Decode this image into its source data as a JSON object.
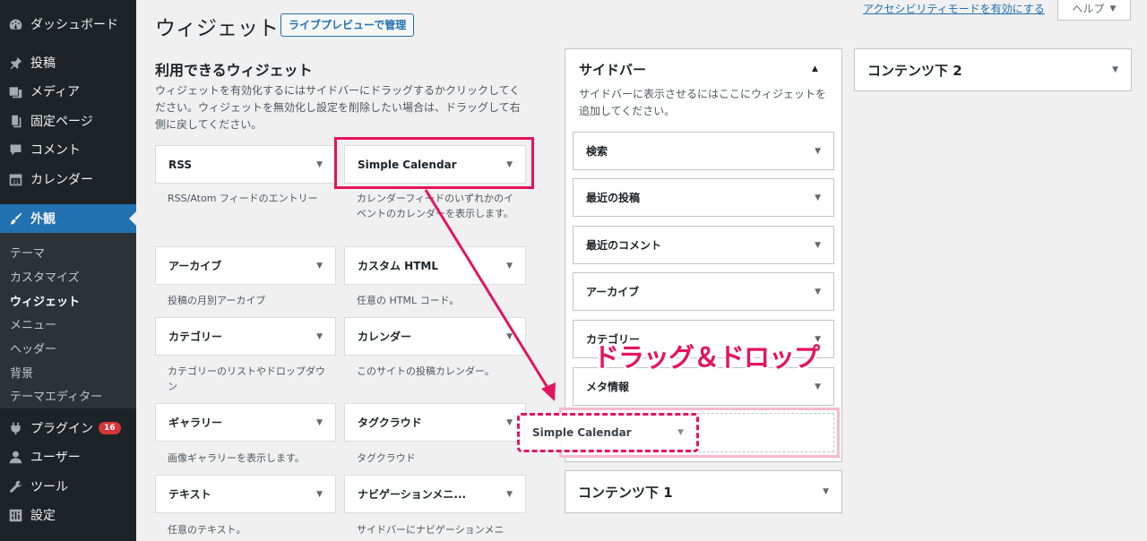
{
  "menu": {
    "dashboard": "ダッシュボード",
    "posts": "投稿",
    "media": "メディア",
    "pages": "固定ページ",
    "comments": "コメント",
    "calendar": "カレンダー",
    "appearance": "外観",
    "plugins": "プラグイン",
    "plugins_badge": "16",
    "users": "ユーザー",
    "tools": "ツール",
    "settings": "設定",
    "submenu": [
      "テーマ",
      "カスタマイズ",
      "ウィジェット",
      "メニュー",
      "ヘッダー",
      "背景",
      "テーマエディター"
    ]
  },
  "header": {
    "title": "ウィジェット",
    "live_preview": "ライブプレビューで管理",
    "accessibility": "アクセシビリティモードを有効にする",
    "help": "ヘルプ"
  },
  "available": {
    "heading": "利用できるウィジェット",
    "description": "ウィジェットを有効化するにはサイドバーにドラッグするかクリックしてください。ウィジェットを無効化し設定を削除したい場合は、ドラッグして右側に戻してください。",
    "widgets": [
      {
        "title": "RSS",
        "desc": "RSS/Atom フィードのエントリー"
      },
      {
        "title": "Simple Calendar",
        "desc": "カレンダーフィードのいずれかのイベントのカレンダーを表示します。"
      },
      {
        "title": "アーカイブ",
        "desc": "投稿の月別アーカイブ"
      },
      {
        "title": "カスタム HTML",
        "desc": "任意の HTML コード。"
      },
      {
        "title": "カテゴリー",
        "desc": "カテゴリーのリストやドロップダウン"
      },
      {
        "title": "カレンダー",
        "desc": "このサイトの投稿カレンダー。"
      },
      {
        "title": "ギャラリー",
        "desc": "画像ギャラリーを表示します。"
      },
      {
        "title": "タグクラウド",
        "desc": "タグクラウド"
      },
      {
        "title": "テキスト",
        "desc": "任意のテキスト。"
      },
      {
        "title": "ナビゲーションメニ...",
        "desc": "サイドバーにナビゲーションメニ"
      }
    ]
  },
  "sidebar": {
    "title": "サイドバー",
    "description": "サイドバーに表示させるにはここにウィジェットを追加してください。",
    "widgets": [
      "検索",
      "最近の投稿",
      "最近のコメント",
      "アーカイブ",
      "カテゴリー",
      "メタ情報"
    ]
  },
  "areas": {
    "content_bottom_2": "コンテンツ下 2",
    "content_bottom_1": "コンテンツ下 1"
  },
  "dragging": {
    "title": "Simple Calendar"
  },
  "annotation": "ドラッグ＆ドロップ",
  "colors": {
    "accent": "#2271b1",
    "menu_bg": "#1d2327",
    "highlight": "#e5135e"
  },
  "icons": [
    "dashboard-icon",
    "pin-icon",
    "media-icon",
    "page-icon",
    "comment-icon",
    "calendar-icon",
    "brush-icon",
    "plugin-icon",
    "user-icon",
    "wrench-icon",
    "settings-icon"
  ]
}
